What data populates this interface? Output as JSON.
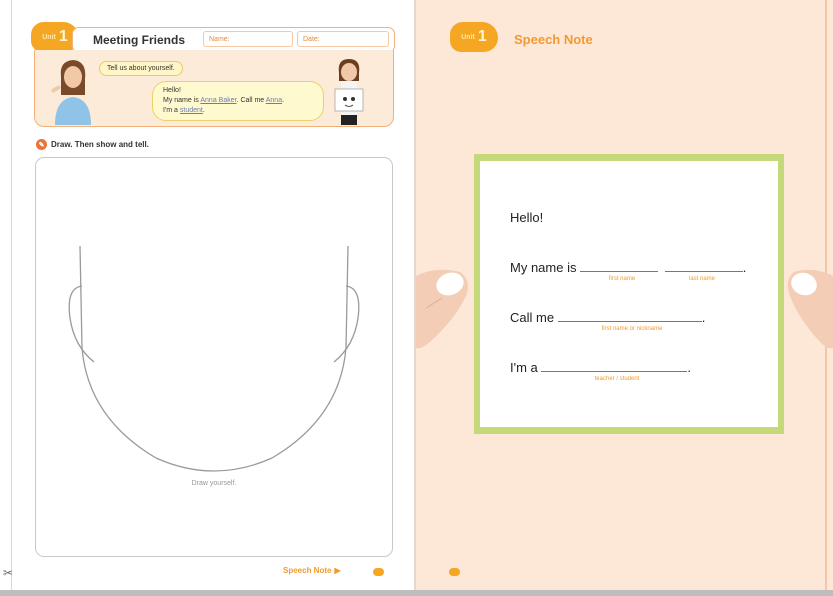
{
  "left_page": {
    "unit_word": "Unit",
    "unit_number": "1",
    "title": "Meeting Friends",
    "name_label": "Name:",
    "date_label": "Date:",
    "bubble_question": "Tell us about yourself.",
    "bubble_answer": {
      "line1": "Hello!",
      "line2_prefix": "My name is ",
      "first_last_name": "Anna Baker",
      "line2_mid": ". Call me ",
      "nickname": "Anna",
      "line2_end": ".",
      "line3_prefix": "I'm a ",
      "role": "student",
      "line3_end": "."
    },
    "instruction": "Draw. Then show and tell.",
    "draw_caption": "Draw yourself.",
    "footer_label": "Speech Note"
  },
  "right_page": {
    "unit_word": "Unit",
    "unit_number": "1",
    "title": "Speech Note",
    "card": {
      "hello": "Hello!",
      "name_prefix": "My name is",
      "name_end": ".",
      "hint_first": "first name",
      "hint_last": "last name",
      "call_prefix": "Call me",
      "call_end": ".",
      "hint_nick": "first name or nickname",
      "role_prefix": "I'm a",
      "role_end": ".",
      "hint_role": "teacher / student"
    }
  },
  "colors": {
    "accent_orange": "#f5a623",
    "right_page_bg": "#fde8d8",
    "card_border": "#c5d87a"
  }
}
